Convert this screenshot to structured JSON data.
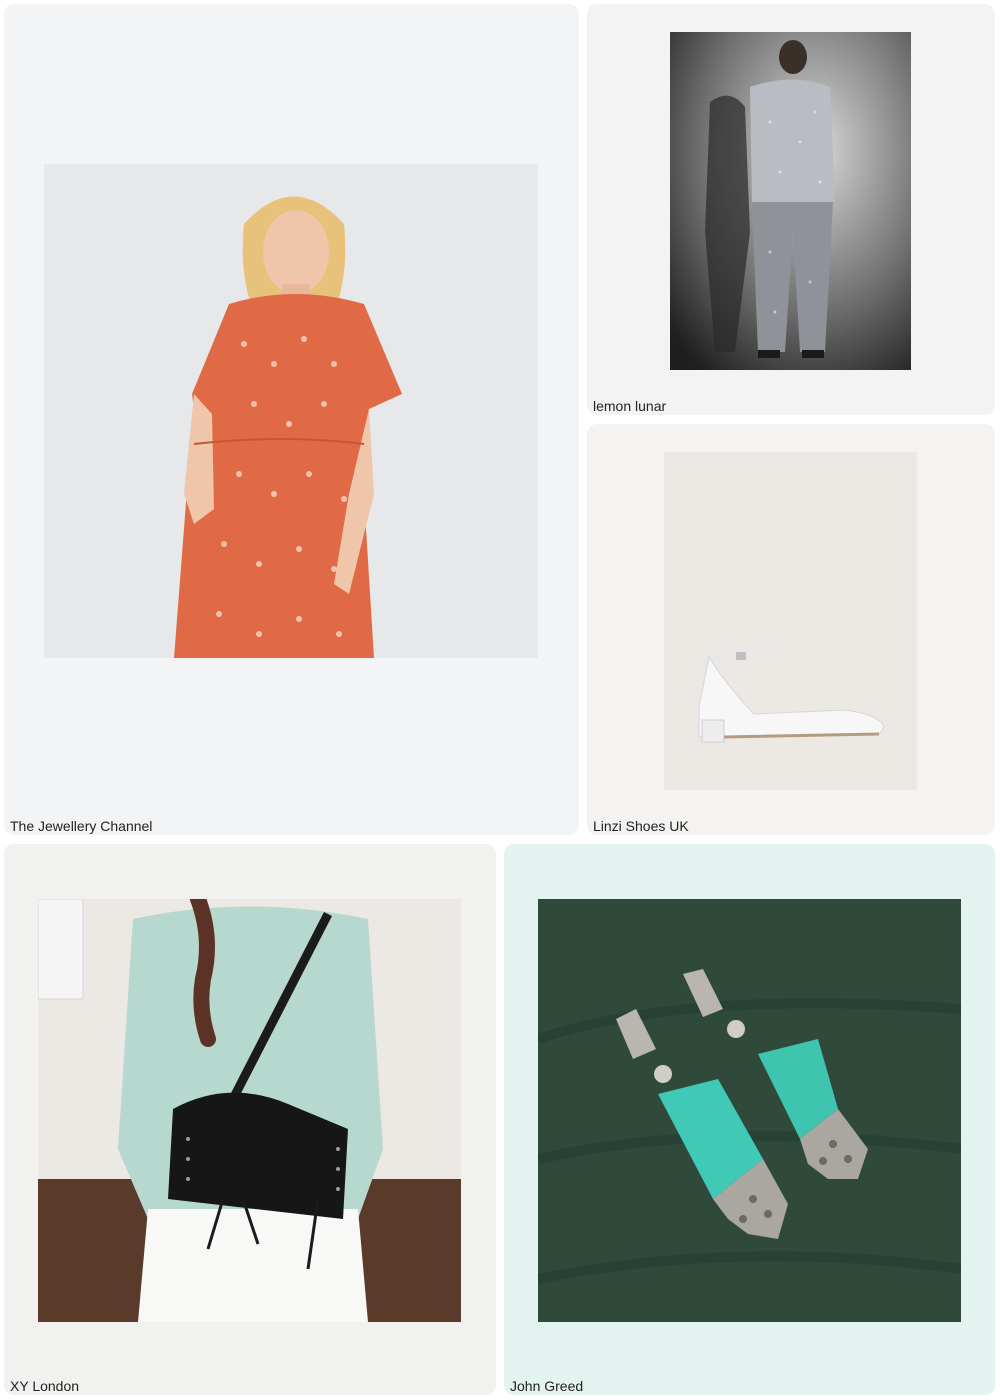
{
  "feed": {
    "cards": [
      {
        "merchant": "The Jewellery Channel",
        "bg": "#f3f4f6",
        "subject": "orange-print-tiered-dress"
      },
      {
        "merchant": "lemon lunar",
        "bg": "#f3f3f3",
        "subject": "silver-sequin-suit"
      },
      {
        "merchant": "Linzi Shoes UK",
        "bg": "#f4f3f1",
        "subject": "white-ankle-strap-flat"
      },
      {
        "merchant": "XY London",
        "bg": "#f1f2ef",
        "subject": "black-leather-shoulder-bag"
      },
      {
        "merchant": "John Greed",
        "bg": "#e3f4f0",
        "subject": "turquoise-marcasite-drop-earrings"
      }
    ]
  }
}
